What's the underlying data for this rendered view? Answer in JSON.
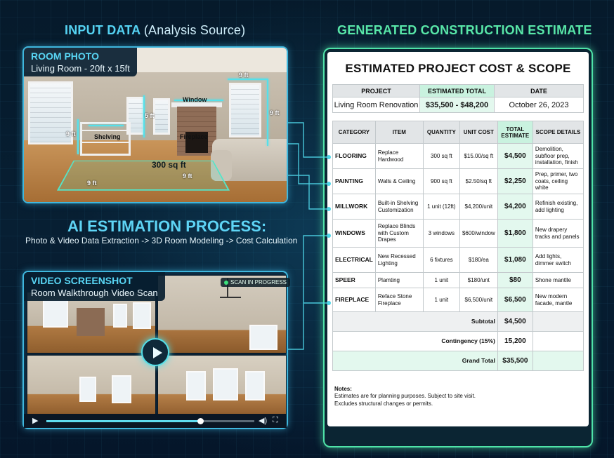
{
  "headers": {
    "input_main": "INPUT DATA",
    "input_paren": "(Analysis Source)",
    "generated": "GENERATED CONSTRUCTION ESTIMATE"
  },
  "room_photo": {
    "title": "ROOM PHOTO",
    "subtitle": "Living Room - 20ft x 15ft",
    "labels": {
      "window": "Window",
      "shelving": "Shelving",
      "fireplace": "Fireplace",
      "area": "300 sq ft",
      "dim_9ft": "9 ft",
      "dim_5ft": "5 ft"
    }
  },
  "ai_process": {
    "title": "AI ESTIMATION PROCESS:",
    "subtitle": "Photo & Video Data Extraction -> 3D Room Modeling -> Cost Calculation"
  },
  "video": {
    "title": "VIDEO SCREENSHOT",
    "subtitle": "Room Walkthrough Video Scan",
    "badge": "SCAN IN PROGRESS",
    "progress": 0.74
  },
  "estimate": {
    "title": "ESTIMATED PROJECT COST & SCOPE",
    "project_headers": {
      "project": "PROJECT",
      "total": "ESTIMATED TOTAL",
      "date": "DATE"
    },
    "project": {
      "name": "Living Room Renovation",
      "total": "$35,500 - $48,200",
      "date": "October 26, 2023"
    },
    "columns": [
      "CATEGORY",
      "ITEM",
      "QUANTITY",
      "UNIT COST",
      "TOTAL ESTIMATE",
      "SCOPE DETAILS"
    ],
    "rows": [
      {
        "category": "FLOORING",
        "item": "Replace Hardwood",
        "quantity": "300 sq ft",
        "unit_cost": "$15.00/sq ft",
        "total": "$4,500",
        "scope": "Demolition, subfloor prep, installation, finish"
      },
      {
        "category": "PAINTING",
        "item": "Walls & Ceiling",
        "quantity": "900 sq ft",
        "unit_cost": "$2.50/sq ft",
        "total": "$2,250",
        "scope": "Prep, primer, two coats, ceiling white"
      },
      {
        "category": "MILLWORK",
        "item": "Built-in Shelving Customization",
        "quantity": "1 unit (12ft)",
        "unit_cost": "$4,200/unit",
        "total": "$4,200",
        "scope": "Refinish existing, add lighting"
      },
      {
        "category": "WINDOWS",
        "item": "Replace Blinds with Custom Drapes",
        "quantity": "3 windows",
        "unit_cost": "$600/window",
        "total": "$1,800",
        "scope": "New drapery tracks and panels"
      },
      {
        "category": "ELECTRICAL",
        "item": "New Recessed Lighting",
        "quantity": "6 fixtures",
        "unit_cost": "$180/ea",
        "total": "$1,080",
        "scope": "Add lights, dimmer switch"
      },
      {
        "category": "SPEER",
        "item": "Plamting",
        "quantity": "1 unit",
        "unit_cost": "$180/unt",
        "total": "$80",
        "scope": "Shone mantlle"
      },
      {
        "category": "FIREPLACE",
        "item": "Reface Stone Fireplace",
        "quantity": "1 unit",
        "unit_cost": "$6,500/unit",
        "total": "$6,500",
        "scope": "New modern facade, mantle"
      }
    ],
    "subtotal_label": "Subtotal",
    "subtotal": "$4,500",
    "contingency_label": "Contingency (15%)",
    "contingency": "15,200",
    "grand_total_label": "Grand Total",
    "grand_total": "$35,500",
    "notes_title": "Notes:",
    "notes_lines": [
      "Estimates are for planning purposes. Subject to site visit.",
      "Excludes structural changes or permits."
    ]
  },
  "colors": {
    "cyan_accent": "#55d3f3",
    "green_accent": "#58e6a8",
    "green_cell": "#e3f8ee"
  }
}
